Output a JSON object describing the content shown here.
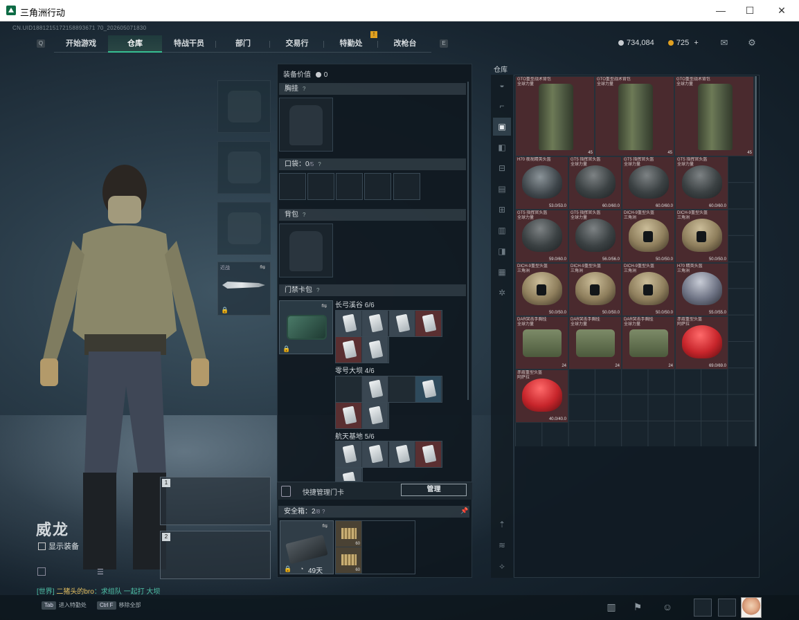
{
  "window": {
    "title": "三角洲行动",
    "minimize": "—",
    "maximize": "☐",
    "close": "✕"
  },
  "session_id": "CN.UID1881215172158893671 70_202605071830",
  "nav": {
    "key_left": "Q",
    "key_right": "E",
    "badge": "!",
    "tabs": [
      "开始游戏",
      "仓库",
      "特战干员",
      "部门",
      "交易行",
      "特勤处",
      "改枪台"
    ],
    "active_tab": 1
  },
  "currency": {
    "silver": "734,084",
    "gold": "725",
    "add": "+"
  },
  "icons": {
    "mail": "mail-icon",
    "settings": "gear-icon"
  },
  "loadout": {
    "melee_label": "近战",
    "weapon_slots": [
      "1",
      "2"
    ],
    "character_name": "威龙",
    "show_equip": "显示装备"
  },
  "chat": {
    "channel": "[世界]",
    "sender": "二猪头的bro",
    "message": "：求组队 一起打 大坝"
  },
  "bottom_hints": [
    {
      "key": "Tab",
      "label": "进入特勤处"
    },
    {
      "key": "Ctrl F",
      "label": "移除全部"
    }
  ],
  "equipment_panel": {
    "value_label": "装备价值",
    "value": "0",
    "chest_rig": "胸挂",
    "pocket_label": "口袋：",
    "pocket_count": "0",
    "pocket_max": "/5",
    "backpack": "背包",
    "keycard_case": "门禁卡包",
    "help": "?",
    "maps": [
      {
        "name": "长弓溪谷",
        "count": "6/6"
      },
      {
        "name": "零号大坝",
        "count": "4/6"
      },
      {
        "name": "航天基地",
        "count": "5/6"
      }
    ],
    "manage_label": "快捷管理门卡",
    "manage_button": "管理",
    "safe_box_label": "安全箱：",
    "safe_box_count": "2",
    "safe_box_max": "/8",
    "safe_box_timer": "49天",
    "safe_items": [
      {
        "count": "60"
      },
      {
        "count": "60"
      }
    ]
  },
  "warehouse": {
    "label": "仓库",
    "items": [
      {
        "name": "GTO重型战术背包\n全球力量",
        "dur": "45"
      },
      {
        "name": "GTO重型战术背包\n全球力量",
        "dur": "45"
      },
      {
        "name": "GTO重型战术背包\n全球力量",
        "dur": "45"
      },
      {
        "name": "H70 夜视精英头盔",
        "dur": "53.0/53.0"
      },
      {
        "name": "GT5 指挥官头盔\n全球力量",
        "dur": "60.0/60.0"
      },
      {
        "name": "GT5 指挥官头盔\n全球力量",
        "dur": "60.0/60.0"
      },
      {
        "name": "GT5 指挥官头盔\n全球力量",
        "dur": "60.0/60.0"
      },
      {
        "name": "GT5 指挥官头盔\n全球力量",
        "dur": "59.0/60.0"
      },
      {
        "name": "GT5 指挥官头盔\n全球力量",
        "dur": "56.0/56.0"
      },
      {
        "name": "DICH-9重型头盔\n三角洲",
        "dur": "50.0/50.0"
      },
      {
        "name": "DICH-9重型头盔\n三角洲",
        "dur": "50.0/50.0"
      },
      {
        "name": "DICH-9重型头盔\n三角洲",
        "dur": "50.0/50.0"
      },
      {
        "name": "DICH-9重型头盔\n三角洲",
        "dur": "50.0/50.0"
      },
      {
        "name": "DICH-9重型头盔\n三角洲",
        "dur": "50.0/50.0"
      },
      {
        "name": "H70 精英头盔\n三角洲",
        "dur": "55.0/55.0"
      },
      {
        "name": "DAR突击手胸挂\n全球力量",
        "dur": "24"
      },
      {
        "name": "DAR突击手胸挂\n全球力量",
        "dur": "24"
      },
      {
        "name": "DAR突击手胸挂\n全球力量",
        "dur": "24"
      },
      {
        "name": "赤霞重型头盔\n阿萨拉",
        "dur": "69.0/69.0"
      },
      {
        "name": "赤霞重型头盔\n阿萨拉",
        "dur": "40.0/40.0"
      }
    ]
  },
  "colors": {
    "accent": "#36c093",
    "rare_red": "#4a2a2e",
    "gold": "#e0a020"
  }
}
